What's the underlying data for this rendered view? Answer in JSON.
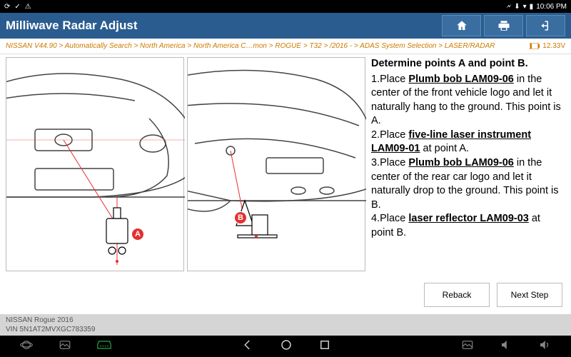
{
  "status": {
    "time": "10:06 PM",
    "icons_left": [
      "sync",
      "check",
      "warning"
    ],
    "icons_right": [
      "bluetooth",
      "download",
      "wifi",
      "battery"
    ]
  },
  "header": {
    "title": "Milliwave Radar Adjust"
  },
  "breadcrumb": {
    "path": "NISSAN V44.90 > Automatically Search > North America > North America C…mon > ROGUE > T32 > /2016 - > ADAS System Selection > LASER/RADAR",
    "voltage": "12.33V"
  },
  "diagram": {
    "label_a": "A",
    "label_b": "B"
  },
  "instructions": {
    "heading": "Determine points A and point B.",
    "steps": [
      {
        "n": "1.",
        "pre": "Place ",
        "tool": "Plumb bob LAM09-06",
        "post": " in the center of the front vehicle logo and let it naturally hang to the ground. This point is A."
      },
      {
        "n": "2.",
        "pre": "Place ",
        "tool": "five-line laser instrument LAM09-01",
        "post": " at point A."
      },
      {
        "n": "3.",
        "pre": "Place ",
        "tool": "Plumb bob LAM09-06",
        "post": " in the center of the rear car logo and let it naturally drop to the ground. This point is B."
      },
      {
        "n": "4.",
        "pre": "Place ",
        "tool": "laser reflector LAM09-03",
        "post": " at point B."
      }
    ]
  },
  "buttons": {
    "reback": "Reback",
    "next": "Next Step"
  },
  "footer": {
    "vehicle": "NISSAN Rogue 2016",
    "vin": "VIN 5N1AT2MVXGC783359"
  }
}
